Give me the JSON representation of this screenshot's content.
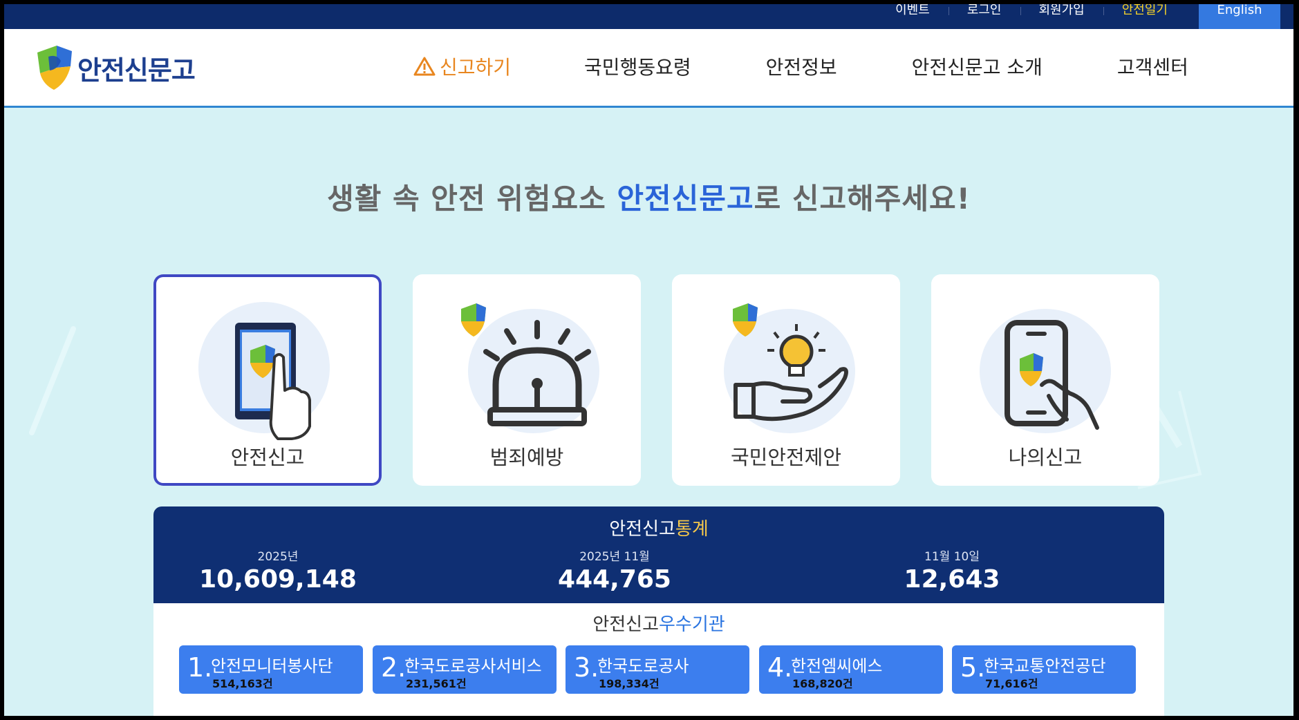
{
  "util_nav": {
    "items": [
      "이벤트",
      "로그인",
      "회원가입",
      "안전일기"
    ],
    "english": "English"
  },
  "header": {
    "logo_text": "안전신문고",
    "nav": [
      "신고하기",
      "국민행동요령",
      "안전정보",
      "안전신문고 소개",
      "고객센터"
    ]
  },
  "hero": {
    "prefix": "생활 속 안전 위험요소 ",
    "accent": "안전신문고",
    "suffix": "로 신고해주세요!"
  },
  "cards": [
    {
      "label": "안전신고",
      "icon": "phone-touch-icon"
    },
    {
      "label": "범죄예방",
      "icon": "alarm-siren-icon"
    },
    {
      "label": "국민안전제안",
      "icon": "hand-lightbulb-icon"
    },
    {
      "label": "나의신고",
      "icon": "phone-hand-icon"
    }
  ],
  "stats": {
    "title_prefix": "안전신고",
    "title_accent": "통계",
    "items": [
      {
        "label": "2025년",
        "value": "10,609,148"
      },
      {
        "label": "2025년 11월",
        "value": "444,765"
      },
      {
        "label": "11월 10일",
        "value": "12,643"
      }
    ]
  },
  "agencies": {
    "title_prefix": "안전신고",
    "title_accent": "우수기관",
    "items": [
      {
        "num": "1.",
        "name": "안전모니터봉사단",
        "count": "514,163건"
      },
      {
        "num": "2.",
        "name": "한국도로공사서비스",
        "count": "231,561건"
      },
      {
        "num": "3.",
        "name": "한국도로공사",
        "count": "198,334건"
      },
      {
        "num": "4.",
        "name": "한전엠씨에스",
        "count": "168,820건"
      },
      {
        "num": "5.",
        "name": "한국교통안전공단",
        "count": "71,616건"
      }
    ]
  },
  "colors": {
    "navy": "#0d2b6b",
    "accent_blue": "#2a64d8",
    "report_orange": "#e8861f",
    "background": "#d6f2f5",
    "agency_blue": "#3c7eee"
  }
}
